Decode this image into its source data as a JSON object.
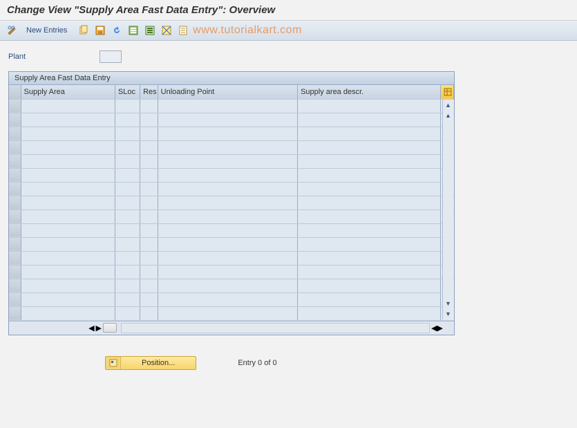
{
  "page_title": "Change View \"Supply Area Fast Data Entry\": Overview",
  "watermark": "www.tutorialkart.com",
  "toolbar": {
    "new_entries": "New Entries"
  },
  "fields": {
    "plant_label": "Plant",
    "plant_value": ""
  },
  "table": {
    "title": "Supply Area Fast Data Entry",
    "columns": {
      "supply_area": "Supply Area",
      "sloc": "SLoc",
      "res": "Res",
      "unloading_point": "Unloading Point",
      "supply_area_descr": "Supply area descr."
    },
    "rows": [
      {},
      {},
      {},
      {},
      {},
      {},
      {},
      {},
      {},
      {},
      {},
      {},
      {},
      {},
      {},
      {}
    ]
  },
  "footer": {
    "position_label": "Position...",
    "entry_counter": "Entry 0 of 0"
  }
}
